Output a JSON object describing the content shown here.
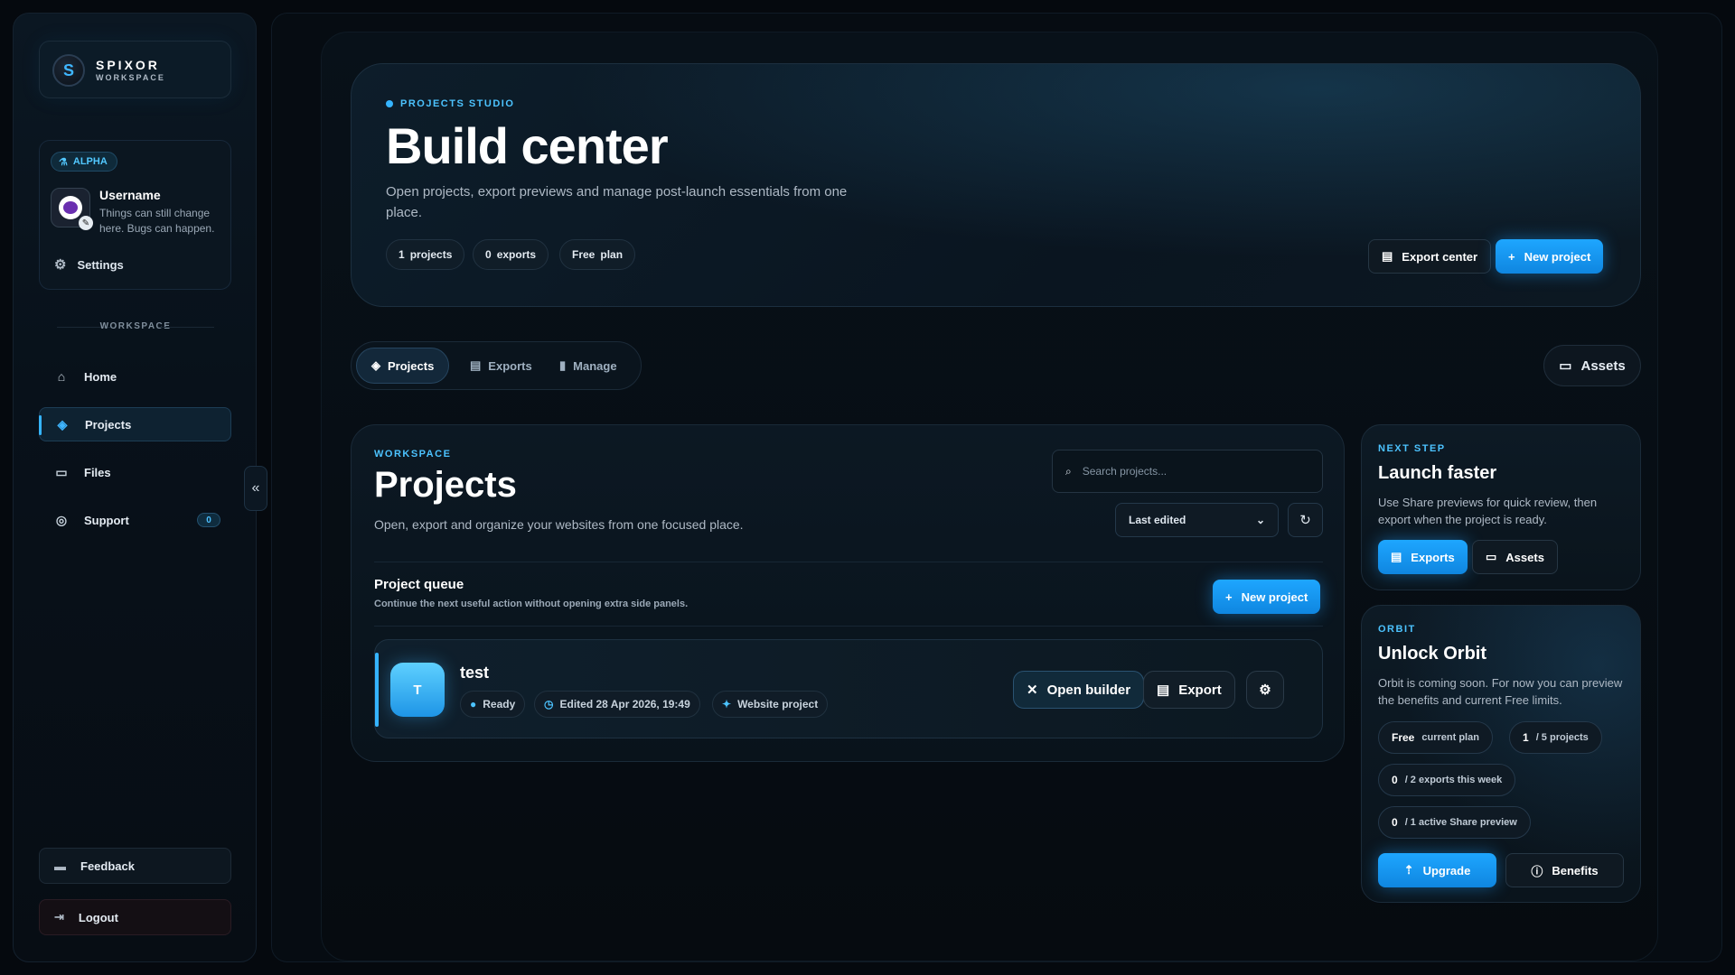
{
  "sidebar": {
    "brand_name": "SPIXOR",
    "brand_sub": "WORKSPACE",
    "badge": "ALPHA",
    "username": "Username",
    "user_desc": "Things can still change here. Bugs can happen.",
    "settings_label": "Settings",
    "section_label": "WORKSPACE",
    "nav": [
      {
        "label": "Home",
        "icon": "home-icon"
      },
      {
        "label": "Projects",
        "icon": "layers-icon",
        "active": true
      },
      {
        "label": "Files",
        "icon": "folder-icon"
      },
      {
        "label": "Support",
        "icon": "lifebuoy-icon",
        "badge": "0"
      }
    ],
    "feedback_label": "Feedback",
    "logout_label": "Logout"
  },
  "hero": {
    "eyebrow": "PROJECTS STUDIO",
    "title": "Build center",
    "description": "Open projects, export previews and manage post-launch essentials from one place.",
    "pills": [
      {
        "value": "1",
        "label": "projects"
      },
      {
        "value": "0",
        "label": "exports"
      },
      {
        "value": "Free",
        "label": "plan"
      }
    ],
    "export_center_label": "Export center",
    "new_project_label": "New project"
  },
  "tabs": [
    {
      "label": "Projects",
      "icon": "layers-icon",
      "active": true
    },
    {
      "label": "Exports",
      "icon": "archive-icon"
    },
    {
      "label": "Manage",
      "icon": "bar-chart-icon"
    }
  ],
  "assets_label": "Assets",
  "projects_panel": {
    "eyebrow": "WORKSPACE",
    "title": "Projects",
    "description": "Open, export and organize your websites from one focused place.",
    "search_placeholder": "Search projects...",
    "sort_value": "Last edited",
    "queue_title": "Project queue",
    "queue_desc": "Continue the next useful action without opening extra side panels.",
    "new_project_label": "New project",
    "project": {
      "initial": "T",
      "name": "test",
      "status": "Ready",
      "edited": "Edited 28 Apr 2026, 19:49",
      "type": "Website project",
      "open_label": "Open builder",
      "export_label": "Export"
    }
  },
  "next_step": {
    "eyebrow": "NEXT STEP",
    "title": "Launch faster",
    "description": "Use Share previews for quick review, then export when the project is ready.",
    "exports_label": "Exports",
    "assets_label": "Assets"
  },
  "orbit": {
    "eyebrow": "ORBIT",
    "title": "Unlock Orbit",
    "description": "Orbit is coming soon. For now you can preview the benefits and current Free limits.",
    "plan_value": "Free",
    "plan_label": "current plan",
    "projects_value": "1",
    "projects_label": "/ 5 projects",
    "exports_value": "0",
    "exports_label": "/ 2 exports this week",
    "share_value": "0",
    "share_label": "/ 1 active Share preview",
    "upgrade_label": "Upgrade",
    "benefits_label": "Benefits"
  },
  "colors": {
    "accent": "#35b4ff",
    "background": "#05090e"
  }
}
